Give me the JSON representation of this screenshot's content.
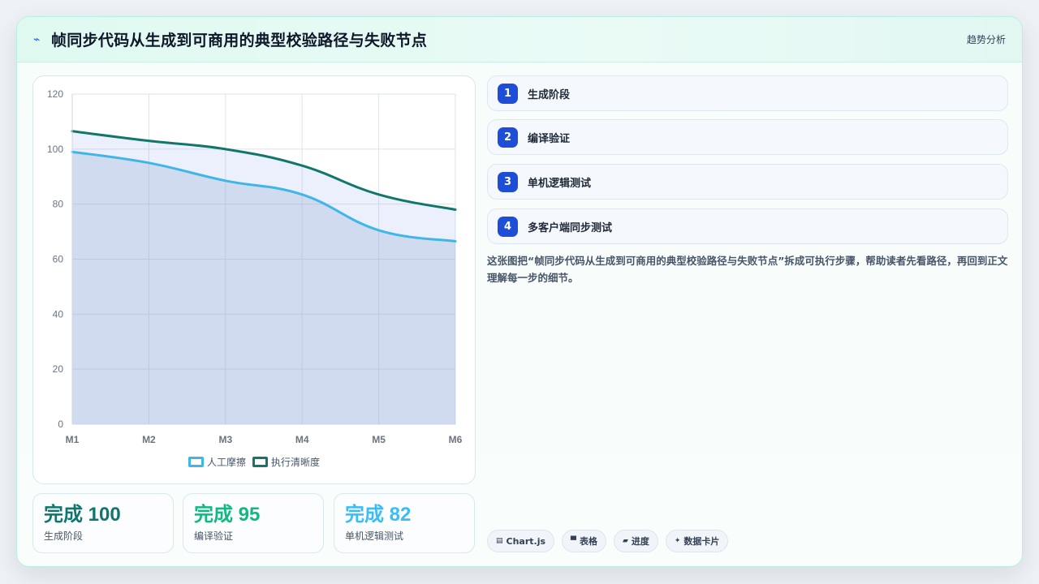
{
  "header": {
    "title": "帧同步代码从生成到可商用的典型校验路径与失败节点",
    "right_label": "趋势分析",
    "icon": "lightning-icon"
  },
  "chart_data": {
    "type": "area",
    "categories": [
      "M1",
      "M2",
      "M3",
      "M4",
      "M5",
      "M6"
    ],
    "ylim": [
      0,
      120
    ],
    "yticks": [
      0,
      20,
      40,
      60,
      80,
      100,
      120
    ],
    "grid": true,
    "legend_position": "bottom",
    "series": [
      {
        "name": "人工摩擦",
        "color": "#3fb6e6",
        "values": [
          99,
          95,
          88.5,
          83.5,
          70.5,
          66.5
        ]
      },
      {
        "name": "执行清晰度",
        "color": "#13766b",
        "values": [
          106.5,
          103,
          100,
          94,
          83.5,
          78
        ]
      }
    ]
  },
  "stats": [
    {
      "value": "完成 100",
      "label": "生成阶段",
      "color": "#0f766e"
    },
    {
      "value": "完成 95",
      "label": "编译验证",
      "color": "#10b981"
    },
    {
      "value": "完成 82",
      "label": "单机逻辑测试",
      "color": "#38bdf8"
    }
  ],
  "steps": [
    {
      "num": "1",
      "label": "生成阶段"
    },
    {
      "num": "2",
      "label": "编译验证"
    },
    {
      "num": "3",
      "label": "单机逻辑测试"
    },
    {
      "num": "4",
      "label": "多客户端同步测试"
    }
  ],
  "description": "这张图把“帧同步代码从生成到可商用的典型校验路径与失败节点”拆成可执行步骤，帮助读者先看路径，再回到正文理解每一步的细节。",
  "tags": [
    {
      "icon": "chart-icon",
      "label": "Chart.js"
    },
    {
      "icon": "table-icon",
      "label": "表格"
    },
    {
      "icon": "progress-icon",
      "label": "进度"
    },
    {
      "icon": "sparkle-icon",
      "label": "数据卡片"
    }
  ]
}
